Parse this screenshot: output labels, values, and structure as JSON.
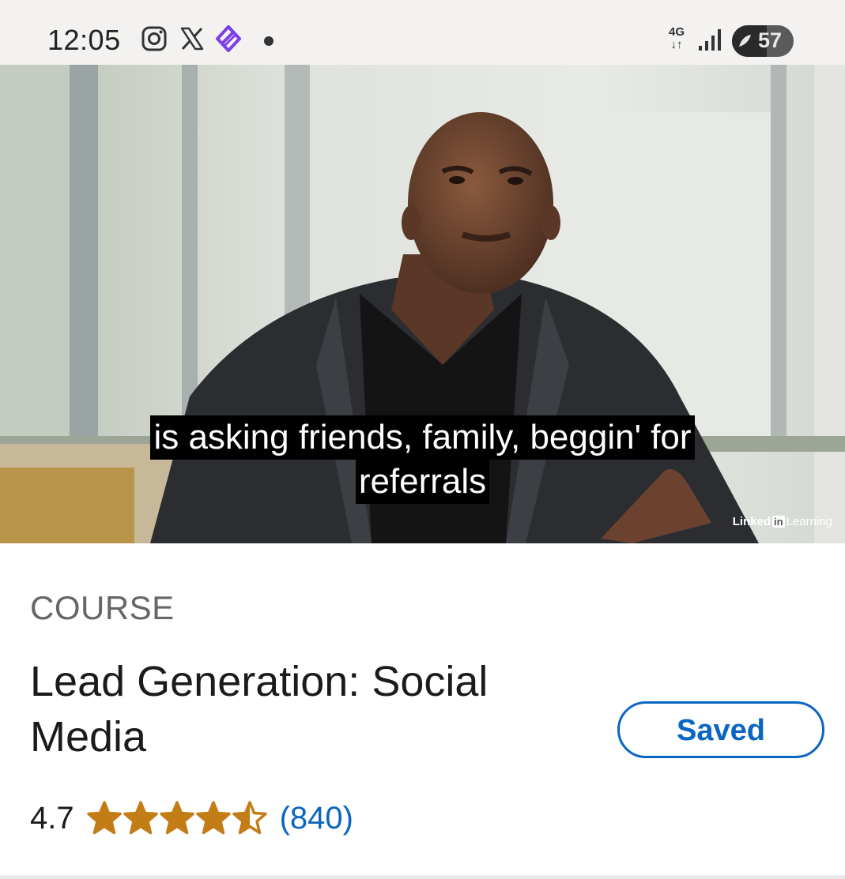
{
  "status_bar": {
    "time": "12:05",
    "network_type": "4G",
    "network_arrows": "↓↑",
    "battery_level": "57",
    "battery_fraction": 0.57,
    "icons": [
      "instagram-icon",
      "x-icon",
      "app-icon",
      "notification-dot-icon",
      "signal-icon",
      "battery-icon"
    ]
  },
  "video": {
    "captions": [
      "is asking friends, family, beggin' for",
      "referrals"
    ],
    "watermark_brand": "Linked",
    "watermark_in": "in",
    "watermark_product": "Learning"
  },
  "course": {
    "type_label": "COURSE",
    "title": "Lead Generation: Social Media",
    "save_label": "Saved",
    "rating": "4.7",
    "rating_value": 4.7,
    "rating_max": 5,
    "rating_count": "(840)"
  },
  "colors": {
    "accent": "#0a66c2",
    "star": "#c37d16",
    "app_icon": "#7b3fe4"
  }
}
